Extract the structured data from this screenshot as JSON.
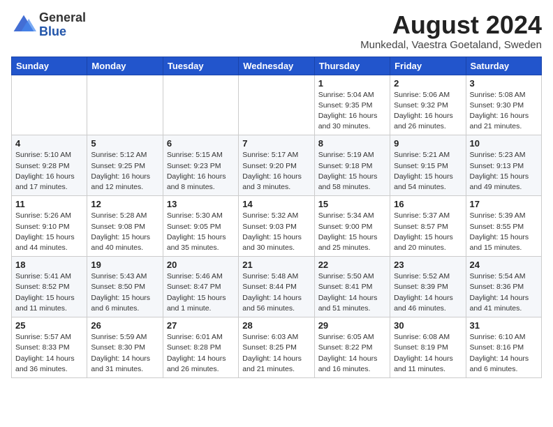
{
  "header": {
    "logo_general": "General",
    "logo_blue": "Blue",
    "month_year": "August 2024",
    "location": "Munkedal, Vaestra Goetaland, Sweden"
  },
  "weekdays": [
    "Sunday",
    "Monday",
    "Tuesday",
    "Wednesday",
    "Thursday",
    "Friday",
    "Saturday"
  ],
  "weeks": [
    [
      {
        "day": "",
        "info": ""
      },
      {
        "day": "",
        "info": ""
      },
      {
        "day": "",
        "info": ""
      },
      {
        "day": "",
        "info": ""
      },
      {
        "day": "1",
        "info": "Sunrise: 5:04 AM\nSunset: 9:35 PM\nDaylight: 16 hours\nand 30 minutes."
      },
      {
        "day": "2",
        "info": "Sunrise: 5:06 AM\nSunset: 9:32 PM\nDaylight: 16 hours\nand 26 minutes."
      },
      {
        "day": "3",
        "info": "Sunrise: 5:08 AM\nSunset: 9:30 PM\nDaylight: 16 hours\nand 21 minutes."
      }
    ],
    [
      {
        "day": "4",
        "info": "Sunrise: 5:10 AM\nSunset: 9:28 PM\nDaylight: 16 hours\nand 17 minutes."
      },
      {
        "day": "5",
        "info": "Sunrise: 5:12 AM\nSunset: 9:25 PM\nDaylight: 16 hours\nand 12 minutes."
      },
      {
        "day": "6",
        "info": "Sunrise: 5:15 AM\nSunset: 9:23 PM\nDaylight: 16 hours\nand 8 minutes."
      },
      {
        "day": "7",
        "info": "Sunrise: 5:17 AM\nSunset: 9:20 PM\nDaylight: 16 hours\nand 3 minutes."
      },
      {
        "day": "8",
        "info": "Sunrise: 5:19 AM\nSunset: 9:18 PM\nDaylight: 15 hours\nand 58 minutes."
      },
      {
        "day": "9",
        "info": "Sunrise: 5:21 AM\nSunset: 9:15 PM\nDaylight: 15 hours\nand 54 minutes."
      },
      {
        "day": "10",
        "info": "Sunrise: 5:23 AM\nSunset: 9:13 PM\nDaylight: 15 hours\nand 49 minutes."
      }
    ],
    [
      {
        "day": "11",
        "info": "Sunrise: 5:26 AM\nSunset: 9:10 PM\nDaylight: 15 hours\nand 44 minutes."
      },
      {
        "day": "12",
        "info": "Sunrise: 5:28 AM\nSunset: 9:08 PM\nDaylight: 15 hours\nand 40 minutes."
      },
      {
        "day": "13",
        "info": "Sunrise: 5:30 AM\nSunset: 9:05 PM\nDaylight: 15 hours\nand 35 minutes."
      },
      {
        "day": "14",
        "info": "Sunrise: 5:32 AM\nSunset: 9:03 PM\nDaylight: 15 hours\nand 30 minutes."
      },
      {
        "day": "15",
        "info": "Sunrise: 5:34 AM\nSunset: 9:00 PM\nDaylight: 15 hours\nand 25 minutes."
      },
      {
        "day": "16",
        "info": "Sunrise: 5:37 AM\nSunset: 8:57 PM\nDaylight: 15 hours\nand 20 minutes."
      },
      {
        "day": "17",
        "info": "Sunrise: 5:39 AM\nSunset: 8:55 PM\nDaylight: 15 hours\nand 15 minutes."
      }
    ],
    [
      {
        "day": "18",
        "info": "Sunrise: 5:41 AM\nSunset: 8:52 PM\nDaylight: 15 hours\nand 11 minutes."
      },
      {
        "day": "19",
        "info": "Sunrise: 5:43 AM\nSunset: 8:50 PM\nDaylight: 15 hours\nand 6 minutes."
      },
      {
        "day": "20",
        "info": "Sunrise: 5:46 AM\nSunset: 8:47 PM\nDaylight: 15 hours\nand 1 minute."
      },
      {
        "day": "21",
        "info": "Sunrise: 5:48 AM\nSunset: 8:44 PM\nDaylight: 14 hours\nand 56 minutes."
      },
      {
        "day": "22",
        "info": "Sunrise: 5:50 AM\nSunset: 8:41 PM\nDaylight: 14 hours\nand 51 minutes."
      },
      {
        "day": "23",
        "info": "Sunrise: 5:52 AM\nSunset: 8:39 PM\nDaylight: 14 hours\nand 46 minutes."
      },
      {
        "day": "24",
        "info": "Sunrise: 5:54 AM\nSunset: 8:36 PM\nDaylight: 14 hours\nand 41 minutes."
      }
    ],
    [
      {
        "day": "25",
        "info": "Sunrise: 5:57 AM\nSunset: 8:33 PM\nDaylight: 14 hours\nand 36 minutes."
      },
      {
        "day": "26",
        "info": "Sunrise: 5:59 AM\nSunset: 8:30 PM\nDaylight: 14 hours\nand 31 minutes."
      },
      {
        "day": "27",
        "info": "Sunrise: 6:01 AM\nSunset: 8:28 PM\nDaylight: 14 hours\nand 26 minutes."
      },
      {
        "day": "28",
        "info": "Sunrise: 6:03 AM\nSunset: 8:25 PM\nDaylight: 14 hours\nand 21 minutes."
      },
      {
        "day": "29",
        "info": "Sunrise: 6:05 AM\nSunset: 8:22 PM\nDaylight: 14 hours\nand 16 minutes."
      },
      {
        "day": "30",
        "info": "Sunrise: 6:08 AM\nSunset: 8:19 PM\nDaylight: 14 hours\nand 11 minutes."
      },
      {
        "day": "31",
        "info": "Sunrise: 6:10 AM\nSunset: 8:16 PM\nDaylight: 14 hours\nand 6 minutes."
      }
    ]
  ]
}
